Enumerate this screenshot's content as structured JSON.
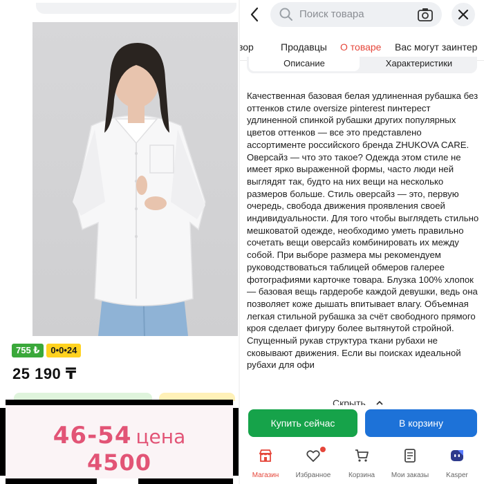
{
  "left": {
    "badges": {
      "bonus": "755 ₺",
      "installment": "0•0•24"
    },
    "price": "25 190 ₸",
    "promo": {
      "sizes": "46-54",
      "price_word": "цена",
      "price_value": "4500"
    }
  },
  "header": {
    "search_placeholder": "Поиск товара",
    "back_icon": "chevron-left-icon",
    "camera_icon": "camera-icon",
    "close_icon": "close-icon"
  },
  "tabs": [
    {
      "label": "зор"
    },
    {
      "label": "Продавцы"
    },
    {
      "label": "О товаре"
    },
    {
      "label": "Вас могут заинтер"
    }
  ],
  "segment": {
    "description": "Описание",
    "specs": "Характеристики"
  },
  "description": "Качественная базовая белая удлиненная рубашка без оттенков стиле oversize pinterest пинтерест удлиненной спинкой рубашки других популярных цветов оттенков — все это представлено ассортименте российского бренда ZHUKOVA CARE. Оверсайз — что это такое? Одежда этом стиле не имеет ярко выраженной формы, часто люди ней выглядят так, будто на них вещи на несколько размеров больше. Стиль оверсайз — это, первую очередь, свобода движения проявления своей индивидуальности. Для того чтобы выглядеть стильно мешковатой одежде, необходимо уметь правильно сочетать вещи оверсайз комбинировать их между собой. При выборе размера мы рекомендуем руководствоваться таблицей обмеров галерее фотографиями карточке товара. Блузка 100% хлопок — базовая вещь гардеробе каждой девушки, ведь она позволяет коже дышать впитывает влагу. Объемная легкая стильной рубашка за счёт свободного прямого кроя сделает фигуру более вытянутой стройной. Спущенный рукав структура ткани рубахи не сковывают движения. Если вы поисках идеальной рубахи для офи",
  "hide_label": "Скрыть",
  "actions": {
    "buy_now": "Купить сейчас",
    "to_cart": "В корзину"
  },
  "nav": [
    {
      "label": "Магазин",
      "icon": "shop-icon"
    },
    {
      "label": "Избранное",
      "icon": "heart-icon"
    },
    {
      "label": "Корзина",
      "icon": "cart-icon"
    },
    {
      "label": "Мои заказы",
      "icon": "orders-icon"
    },
    {
      "label": "Kasper",
      "icon": "assistant-icon"
    }
  ],
  "colors": {
    "accent_red": "#e5463a",
    "buy_green": "#16a34a",
    "cart_blue": "#1d72d8",
    "promo_pink": "#e25476"
  }
}
